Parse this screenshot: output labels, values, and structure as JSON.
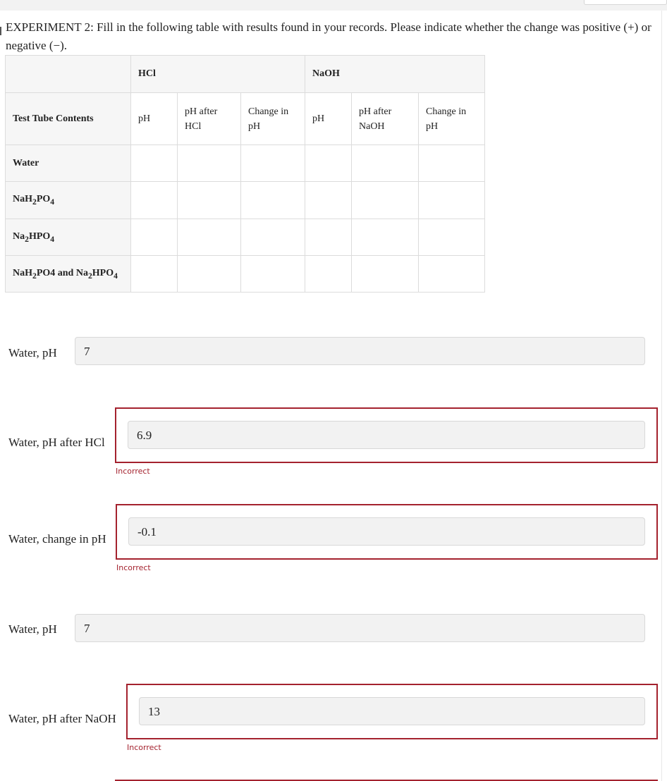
{
  "intro": "EXPERIMENT 2: Fill in the following table with results found in your records. Please indicate whether the change was positive (+) or negative (−).",
  "table": {
    "groups": [
      "HCl",
      "NaOH"
    ],
    "row_header_label": "Test Tube Contents",
    "subheaders": [
      "pH",
      "pH after HCl",
      "Change in pH",
      "pH",
      "pH after NaOH",
      "Change in pH"
    ],
    "rows": [
      {
        "label": "Water",
        "cells": [
          "",
          "",
          "",
          "",
          "",
          ""
        ]
      },
      {
        "label": "NaH2PO4",
        "cells": [
          "",
          "",
          "",
          "",
          "",
          ""
        ]
      },
      {
        "label": "Na2HPO4",
        "cells": [
          "",
          "",
          "",
          "",
          "",
          ""
        ]
      },
      {
        "label": "NaH2PO4 and Na2HPO4",
        "cells": [
          "",
          "",
          "",
          "",
          "",
          ""
        ]
      }
    ]
  },
  "fields": [
    {
      "label": "Water, pH",
      "value": "7",
      "status": ""
    },
    {
      "label": "Water, pH after HCl",
      "value": "6.9",
      "status": "Incorrect"
    },
    {
      "label": "Water, change in pH",
      "value": "-0.1",
      "status": "Incorrect"
    },
    {
      "label": "Water, pH",
      "value": "7",
      "status": ""
    },
    {
      "label": "Water, pH after NaOH",
      "value": "13",
      "status": "Incorrect"
    }
  ],
  "colors": {
    "error": "#a4222e",
    "input_bg": "#f2f2f2",
    "header_bg": "#f6f6f6"
  }
}
